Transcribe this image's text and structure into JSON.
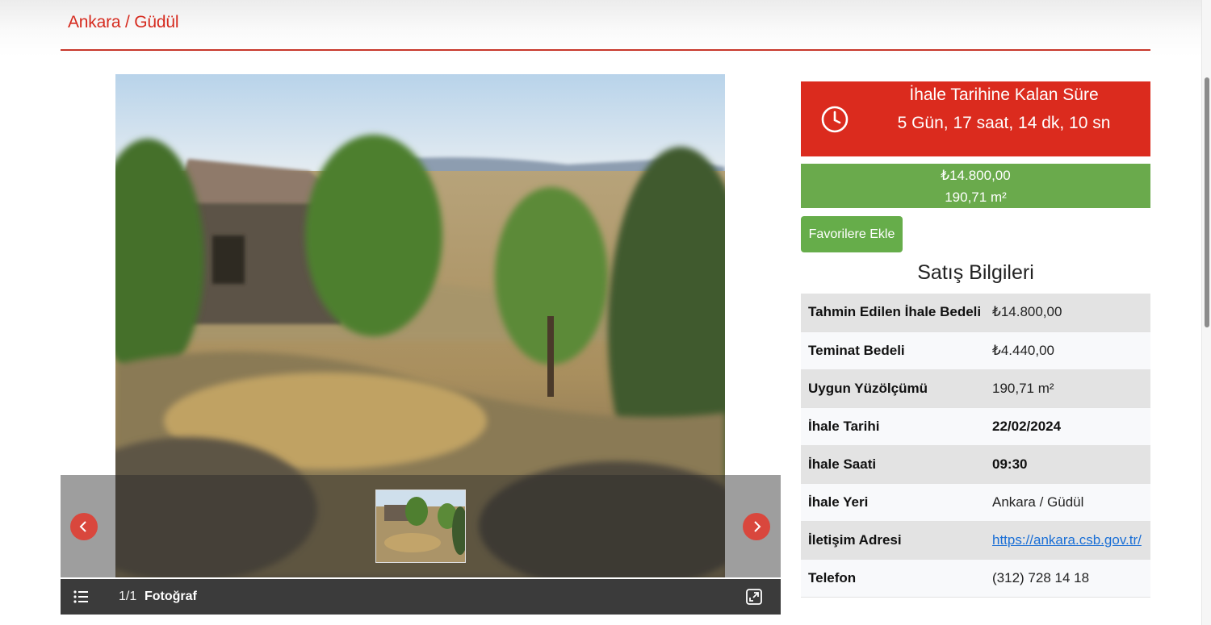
{
  "header": {
    "title": "Ankara / Güdül"
  },
  "gallery": {
    "counter": "1/1",
    "label": "Fotoğraf",
    "icons": [
      "chevron-left-icon",
      "chevron-right-icon",
      "list-icon",
      "fullscreen-icon"
    ]
  },
  "countdown": {
    "title": "İhale Tarihine Kalan Süre",
    "time": "5 Gün, 17 saat, 14 dk, 10 sn",
    "icon": "clock-icon"
  },
  "price": {
    "amount": "₺14.800,00",
    "area": "190,71 m²"
  },
  "favorite_button": "Favorilere Ekle",
  "sales_info": {
    "title": "Satış Bilgileri",
    "rows": [
      {
        "label": "Tahmin Edilen İhale Bedeli",
        "value": "₺14.800,00"
      },
      {
        "label": "Teminat Bedeli",
        "value": "₺4.440,00"
      },
      {
        "label": "Uygun Yüzölçümü",
        "value": "190,71 m²"
      },
      {
        "label": "İhale Tarihi",
        "value": "22/02/2024"
      },
      {
        "label": "İhale Saati",
        "value": "09:30"
      },
      {
        "label": "İhale Yeri",
        "value": "Ankara / Güdül"
      },
      {
        "label": "İletişim Adresi",
        "value": "https://ankara.csb.gov.tr/"
      },
      {
        "label": "Telefon",
        "value": "(312) 728 14 18"
      }
    ]
  },
  "colors": {
    "accent_red": "#db2b1e",
    "accent_green": "#6aaa4c",
    "link": "#1a6fd6"
  }
}
